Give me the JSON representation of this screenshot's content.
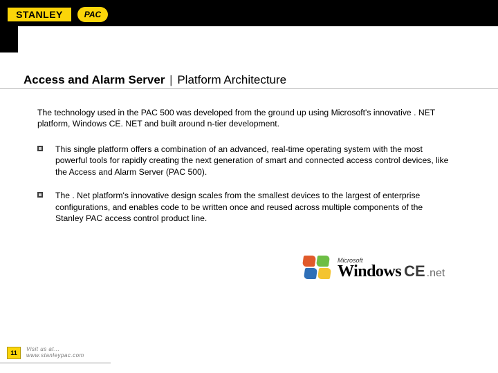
{
  "header": {
    "brand_primary": "STANLEY",
    "brand_secondary": "PAC"
  },
  "title": {
    "main": "Access and Alarm Server",
    "separator": "|",
    "subtitle": "Platform Architecture"
  },
  "intro": "The technology used in the PAC 500 was developed from the ground up using Microsoft's innovative . NET platform, Windows CE. NET and built around n-tier development.",
  "bullets": [
    "This single platform offers a combination of an advanced, real-time operating system with the most powerful tools for rapidly creating the next generation of smart and connected access control devices, like the Access and Alarm Server (PAC 500).",
    "The . Net platform's innovative design scales from the smallest devices to the largest of enterprise configurations, and enables code to be written once and reused across multiple components of the Stanley PAC access control product line."
  ],
  "logo": {
    "microsoft": "Microsoft",
    "windows": "Windows",
    "ce": "CE",
    "net": ".net"
  },
  "footer": {
    "page": "11",
    "visit_label": "Visit us at…",
    "url": "www.stanleypac.com"
  },
  "colors": {
    "brand_yellow": "#FBD509",
    "black": "#000000"
  }
}
